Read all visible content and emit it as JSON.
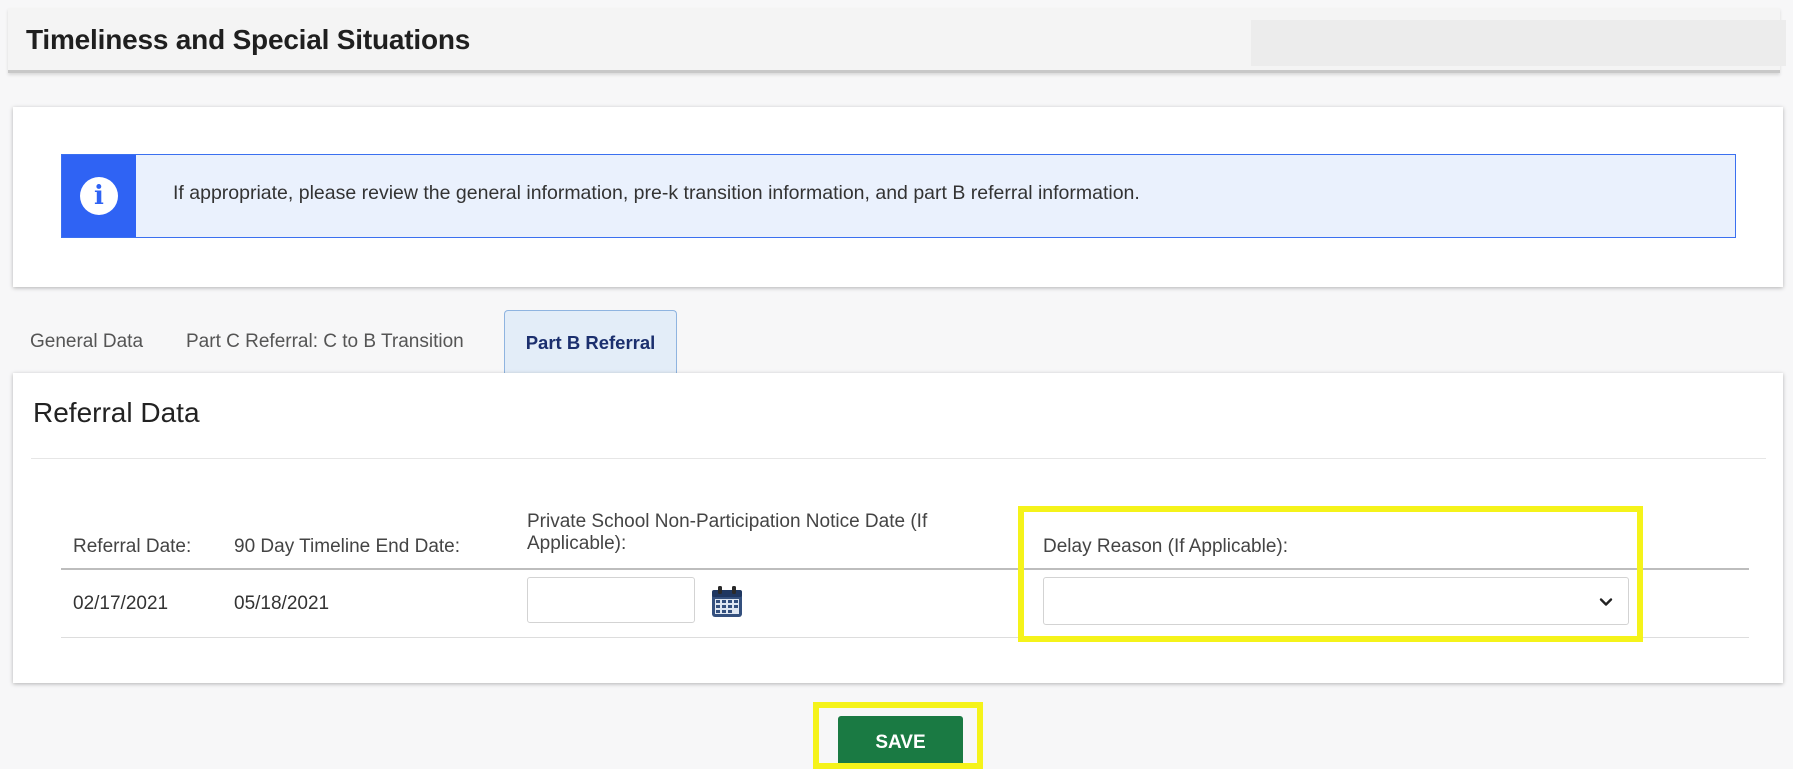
{
  "header": {
    "title": "Timeliness and Special Situations"
  },
  "info_alert": {
    "icon": "info-icon",
    "icon_glyph": "i",
    "message": "If appropriate, please review the general information, pre-k transition information, and part B referral information."
  },
  "tabs": [
    {
      "label": "General Data",
      "active": false
    },
    {
      "label": "Part C Referral: C to B Transition",
      "active": false
    },
    {
      "label": "Part B Referral",
      "active": true
    }
  ],
  "referral": {
    "title": "Referral Data",
    "columns": {
      "referral_date": "Referral Date:",
      "timeline_end": "90 Day Timeline End Date:",
      "private_notice": "Private School Non-Participation Notice Date (If Applicable):",
      "delay_reason": "Delay Reason (If Applicable):"
    },
    "row": {
      "referral_date": "02/17/2021",
      "timeline_end": "05/18/2021",
      "private_notice": "",
      "delay_reason": ""
    }
  },
  "actions": {
    "save_label": "SAVE"
  },
  "colors": {
    "accent_blue": "#2f63f4",
    "save_green": "#1a7a43",
    "highlight_yellow": "#f5f31a"
  }
}
